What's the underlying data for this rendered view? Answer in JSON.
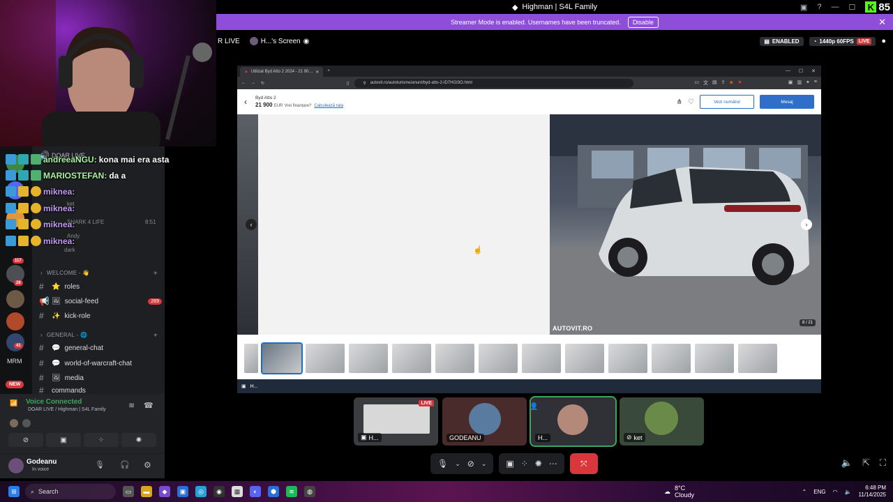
{
  "window": {
    "title": "Highman | S4L Family",
    "kick_count": "85"
  },
  "banner": {
    "text": "Streamer Mode is enabled. Usernames have been truncated.",
    "disable_label": "Disable"
  },
  "stream_header": {
    "live_text": "R LIVE",
    "screen_owner": "H...'s Screen",
    "enabled": "ENABLED",
    "quality": "1440p 60FPS",
    "live_badge": "LIVE"
  },
  "browser": {
    "tab_title": "Utilizat Byd Atto 2 2024 - 21 90…",
    "url": "autovit.ro/autoturisme/anunt/byd-atto-2-ID7HGI3O.html",
    "listing": {
      "name": "Byd Atto 2",
      "price": "21 900",
      "currency": "EUR",
      "financing_q": "Vrei finanțare?",
      "calc_link": "Calculează rata",
      "show_number": "Vezi numărul",
      "message": "Mesaj",
      "watermark": "AUTOVIT.RO",
      "photo_counter": "8 / 21"
    },
    "taskbar_label": "H..."
  },
  "participants": [
    {
      "label": "H...",
      "live": "LIVE"
    },
    {
      "label": "GODEANU"
    },
    {
      "label": "H..."
    },
    {
      "label": "ket"
    }
  ],
  "chat": [
    {
      "name": "andreeaNGU:",
      "text": "kona mai era asta",
      "color": "#a7f3a0"
    },
    {
      "name": "MARIOSTEFAN:",
      "text": "da a",
      "color": "#a7f3a0"
    },
    {
      "name": "miknea:",
      "text": "",
      "color": "#c39bf7"
    },
    {
      "name": "miknea:",
      "text": "",
      "color": "#c39bf7"
    },
    {
      "name": "miknea:",
      "text": "",
      "color": "#c39bf7"
    },
    {
      "name": "miknea:",
      "text": "",
      "color": "#c39bf7"
    }
  ],
  "channels": {
    "under_chat": {
      "doar_live": "DOAR LIVE",
      "ket": "ket",
      "shark": "SHARK 4 LIFE",
      "time": "8:51",
      "andy": "Andy",
      "dark": "dark"
    },
    "welcome_cat": "WELCOME - 👋",
    "welcome": [
      {
        "name": "roles",
        "badge": ""
      },
      {
        "name": "social-feed",
        "badge": "269"
      },
      {
        "name": "kick-role",
        "badge": ""
      }
    ],
    "general_cat": "GENERAL - 🌐",
    "general": [
      {
        "name": "general-chat",
        "badge": ""
      },
      {
        "name": "world-of-warcraft-chat",
        "badge": ""
      },
      {
        "name": "media",
        "badge": ""
      },
      {
        "name": "commands",
        "badge": ""
      }
    ]
  },
  "server_badges": [
    "117",
    "26",
    "41",
    "MRM",
    "NEW"
  ],
  "voice": {
    "status": "Voice Connected",
    "channel": "DOAR LIVE / Highman | S4L Family"
  },
  "user": {
    "name": "Godeanu",
    "status": "In voice"
  },
  "taskbar": {
    "search": "Search",
    "weather_temp": "8°C",
    "weather_desc": "Cloudy",
    "lang": "ENG",
    "time": "6:48 PM",
    "date": "11/14/2025"
  }
}
